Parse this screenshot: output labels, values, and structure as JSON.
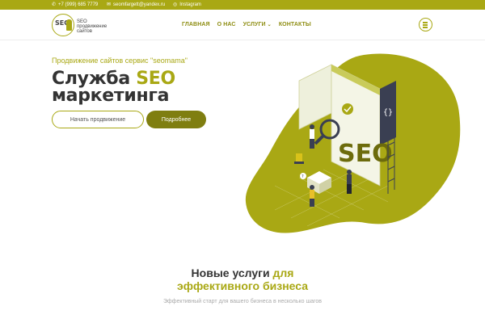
{
  "topbar": {
    "phone": "+7 (999) 685 7779",
    "email": "seomfargett@yandex.ru",
    "social": "Instagram"
  },
  "header": {
    "logo_text": "SEO",
    "logo_caption_line1": "SEO",
    "logo_caption_line2": "продвижение",
    "logo_caption_line3": "сайтов",
    "nav": [
      {
        "label": "ГЛАВНАЯ"
      },
      {
        "label": "О НАС"
      },
      {
        "label": "УСЛУГИ"
      },
      {
        "label": "КОНТАКТЫ"
      }
    ]
  },
  "hero": {
    "subtitle": "Продвижение сайтов сервис \"seomama\"",
    "title_line1_part1": "Служба ",
    "title_line1_accent": "SEO",
    "title_line2": "маркетинга",
    "btn_start": "Начать продвижение",
    "btn_more": "Подробнее",
    "illustration_word": "SEO"
  },
  "section": {
    "title_line1_part1": "Новые услуги ",
    "title_line1_accent": "для",
    "title_line2": "эффективного бизнеса",
    "description": "Эффективный старт для вашего бизнеса в несколько шагов"
  },
  "colors": {
    "accent": "#a9a814",
    "accent_dark": "#7f7e10",
    "text_dark": "#333333"
  }
}
